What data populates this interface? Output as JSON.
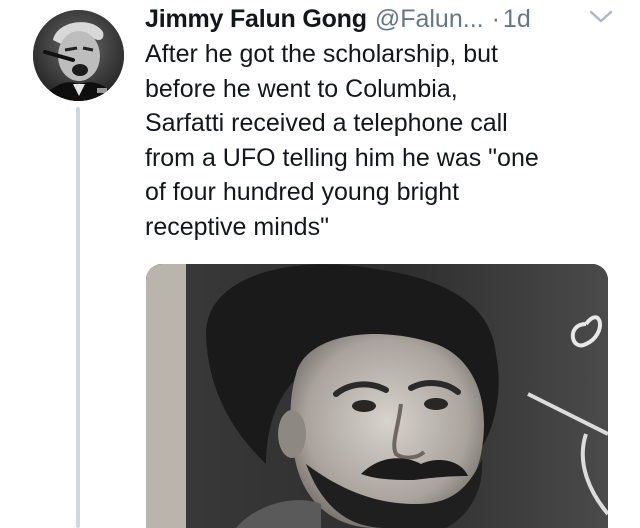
{
  "tweet": {
    "author": {
      "display_name": "Jimmy Falun Gong",
      "handle": "@Falun...",
      "avatar_icon": "profile-photo"
    },
    "separator": "·",
    "timestamp": "1d",
    "menu_icon": "chevron-down-icon",
    "text": "After he got the scholarship, but\nbefore he went to Columbia,\nSarfatti received a telephone call\nfrom a UFO telling him he was \"one\nof four hundred young bright\nreceptive minds\"",
    "media": {
      "type": "photo",
      "description_icon": "black-and-white-portrait"
    }
  },
  "colors": {
    "text_primary": "#14171a",
    "text_secondary": "#657786",
    "thread_line": "#d0d8df"
  }
}
